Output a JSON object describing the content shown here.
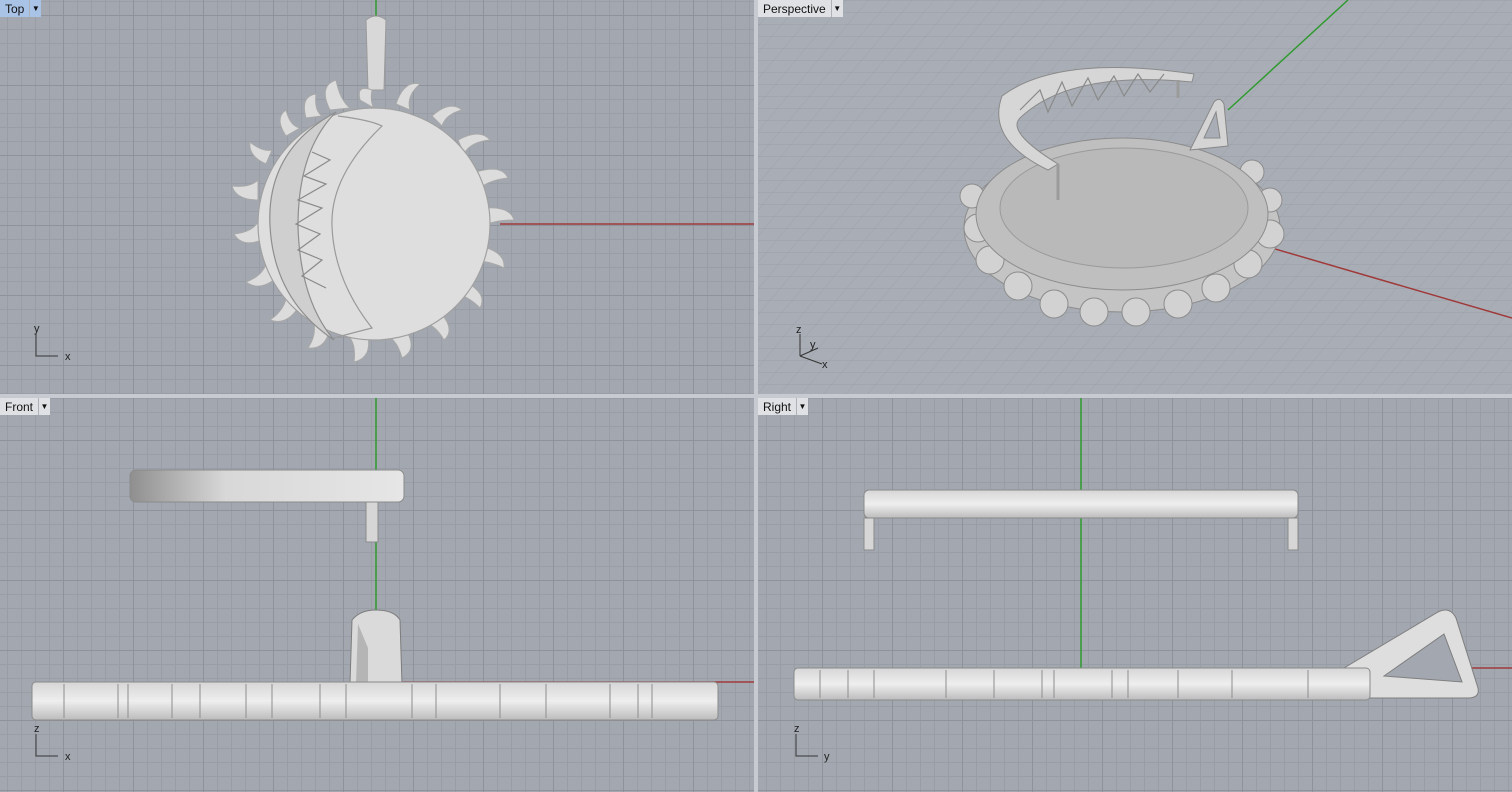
{
  "viewports": {
    "top": {
      "title": "Top",
      "dropdown_icon": "triangle-down",
      "axis_v": "y",
      "axis_h": "x"
    },
    "persp": {
      "title": "Perspective",
      "dropdown_icon": "triangle-down",
      "axis_z": "z",
      "axis_y": "y",
      "axis_x": "x"
    },
    "front": {
      "title": "Front",
      "dropdown_icon": "triangle-down",
      "axis_v": "z",
      "axis_h": "x"
    },
    "right": {
      "title": "Right",
      "dropdown_icon": "triangle-down",
      "axis_v": "z",
      "axis_h": "y"
    }
  },
  "colors": {
    "x_axis": "#a03a3a",
    "y_axis": "#2f9a2f",
    "active_tab": "#a9c3e6",
    "grid_bg": "#a3a8b0",
    "model": "#d9d9d9"
  }
}
